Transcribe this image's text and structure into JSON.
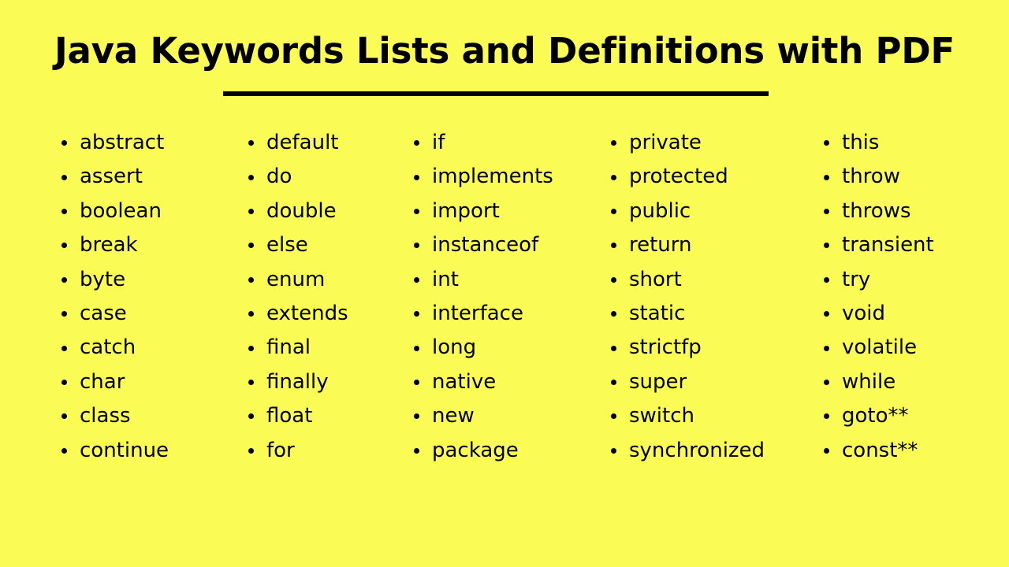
{
  "slide": {
    "background_color": "#fbfb55",
    "text_color": "#000000",
    "title": "Java Keywords Lists and Definitions with PDF",
    "divider": "horizontal-rule"
  },
  "columns": [
    {
      "name": "column-1",
      "items": [
        "abstract",
        "assert",
        "boolean",
        "break",
        "byte",
        "case",
        "catch",
        "char",
        "class",
        "continue"
      ]
    },
    {
      "name": "column-2",
      "items": [
        "default",
        "do",
        "double",
        "else",
        "enum",
        "extends",
        "final",
        "finally",
        "float",
        "for"
      ]
    },
    {
      "name": "column-3",
      "items": [
        "if",
        "implements",
        "import",
        "instanceof",
        "int",
        "interface",
        "long",
        "native",
        "new",
        "package"
      ]
    },
    {
      "name": "column-4",
      "items": [
        "private",
        "protected",
        "public",
        "return",
        "short",
        "static",
        "strictfp",
        "super",
        "switch",
        "synchronized"
      ]
    },
    {
      "name": "column-5",
      "items": [
        "this",
        "throw",
        "throws",
        "transient",
        "try",
        "void",
        "volatile",
        "while",
        "goto**",
        "const**"
      ]
    }
  ]
}
